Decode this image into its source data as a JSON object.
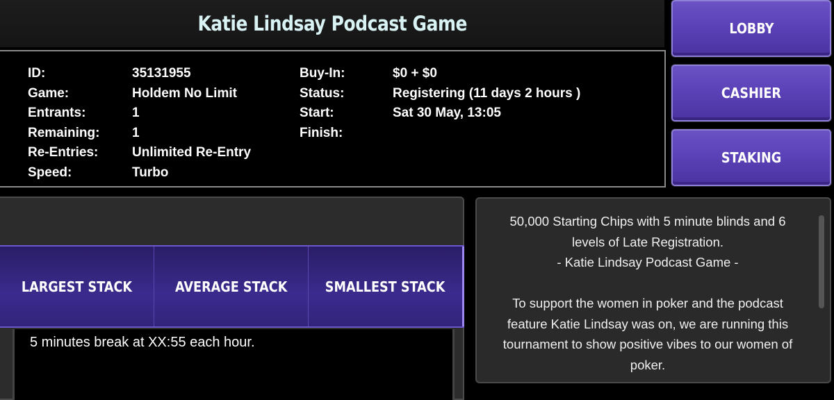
{
  "header": {
    "title": "Katie Lindsay Podcast Game"
  },
  "info_left": [
    {
      "label": "ID:",
      "value": "35131955"
    },
    {
      "label": "Game:",
      "value": "Holdem No Limit"
    },
    {
      "label": "Entrants:",
      "value": "1"
    },
    {
      "label": "Remaining:",
      "value": "1"
    },
    {
      "label": "Re-Entries:",
      "value": "Unlimited Re-Entry"
    },
    {
      "label": "Speed:",
      "value": "Turbo"
    }
  ],
  "info_right": [
    {
      "label": "Buy-In:",
      "value": "$0 + $0"
    },
    {
      "label": "Status:",
      "value": "Registering (11 days 2 hours )"
    },
    {
      "label": "Start:",
      "value": "Sat 30 May, 13:05"
    },
    {
      "label": "Finish:",
      "value": ""
    }
  ],
  "side_buttons": {
    "lobby": "LOBBY",
    "cashier": "CASHIER",
    "staking": "STAKING"
  },
  "stack_tabs": {
    "largest": "LARGEST STACK",
    "average": "AVERAGE STACK",
    "smallest": "SMALLEST STACK"
  },
  "break_note": "5 minutes break at XX:55 each hour.",
  "description": {
    "line1": "50,000 Starting Chips with 5 minute blinds and 6",
    "line2": "levels of Late Registration.",
    "line3": "- Katie Lindsay Podcast Game -",
    "line4": "To support the women in poker and the podcast",
    "line5": "feature Katie Lindsay was on, we are running this",
    "line6": "tournament to show positive vibes to our women of",
    "line7": "poker."
  },
  "colors": {
    "accent": "#5b42b8",
    "title": "#d9f3f5"
  }
}
